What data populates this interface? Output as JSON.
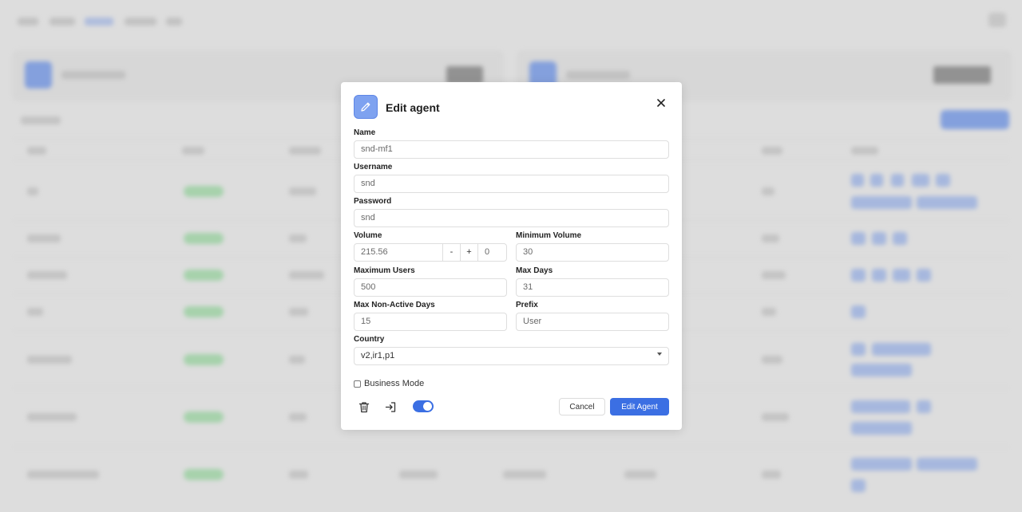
{
  "modal": {
    "title": "Edit agent",
    "icon": "pencil-icon",
    "close_icon": "close-icon"
  },
  "form": {
    "name": {
      "label": "Name",
      "value": "snd-mf1"
    },
    "username": {
      "label": "Username",
      "value": "snd"
    },
    "password": {
      "label": "Password",
      "value": "snd"
    },
    "volume": {
      "label": "Volume",
      "value": "215.56",
      "minus": "-",
      "plus": "+",
      "step": "0"
    },
    "minimum_volume": {
      "label": "Minimum Volume",
      "value": "30"
    },
    "maximum_users": {
      "label": "Maximum Users",
      "value": "500"
    },
    "max_days": {
      "label": "Max Days",
      "value": "31"
    },
    "max_non_active_days": {
      "label": "Max Non-Active Days",
      "value": "15"
    },
    "prefix": {
      "label": "Prefix",
      "value": "User"
    },
    "country": {
      "label": "Country",
      "value": "v2,ir1,p1"
    },
    "business_mode": {
      "label": "Business Mode",
      "checked": false
    }
  },
  "footer": {
    "delete_icon": "trash-icon",
    "login_icon": "sign-in-icon",
    "toggle_on": true,
    "cancel_label": "Cancel",
    "submit_label": "Edit Agent"
  },
  "colors": {
    "primary": "#3b6fe3",
    "header_icon_bg": "#7ea2f0",
    "status_green": "#7fd28a"
  }
}
